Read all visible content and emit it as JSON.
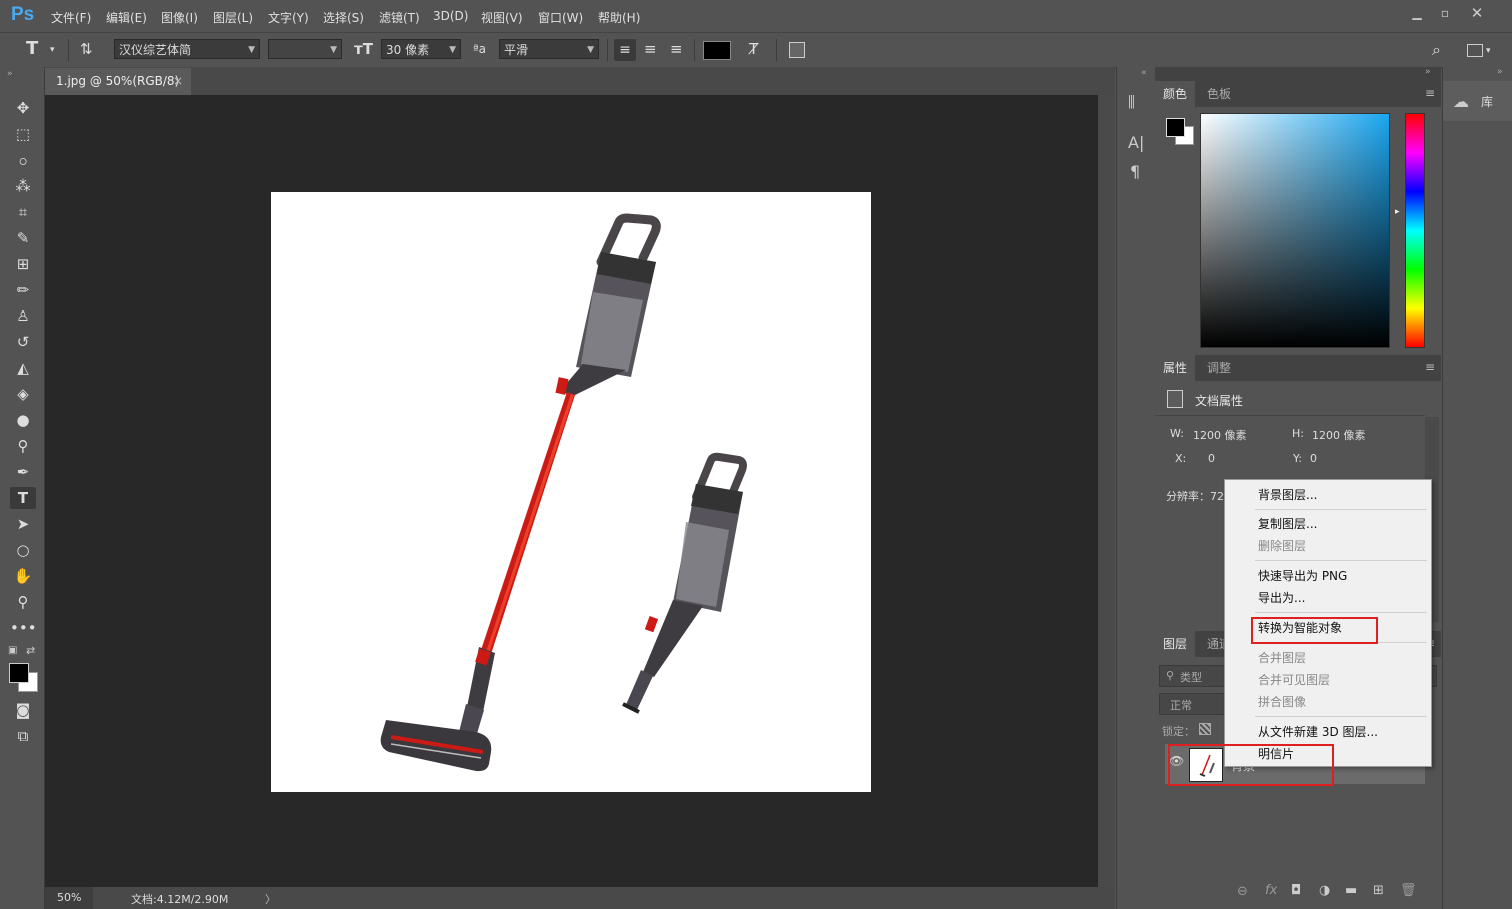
{
  "menubar": {
    "logo": "Ps",
    "items": [
      "文件(F)",
      "编辑(E)",
      "图像(I)",
      "图层(L)",
      "文字(Y)",
      "选择(S)",
      "滤镜(T)",
      "3D(D)",
      "视图(V)",
      "窗口(W)",
      "帮助(H)"
    ]
  },
  "options": {
    "font_family": "汉仪综艺体简",
    "font_style": "",
    "font_size": "30 像素",
    "antialias": "平滑",
    "color": "#000000"
  },
  "document": {
    "tab_title": "1.jpg @ 50%(RGB/8)",
    "tab_close": "×",
    "zoom": "50%",
    "doc_info": "文档:4.12M/2.90M",
    "status_arrow": "〉"
  },
  "color_panel": {
    "tabs": [
      "颜色",
      "色板"
    ],
    "foreground": "#000000",
    "background": "#ffffff"
  },
  "properties_panel": {
    "tabs": [
      "属性",
      "调整"
    ],
    "section_title": "文档属性",
    "w_label": "W:",
    "w_value": "1200 像素",
    "h_label": "H:",
    "h_value": "1200 像素",
    "x_label": "X:",
    "x_value": "0",
    "y_label": "Y:",
    "y_value": "0",
    "resolution_label": "分辨率：72"
  },
  "layers_panel": {
    "tabs": [
      "图层",
      "通道"
    ],
    "filter_label": "类型",
    "blend_mode": "正常",
    "lock_label": "锁定：",
    "layer_name": "背景"
  },
  "library_panel": {
    "label": "库"
  },
  "context_menu": {
    "items": [
      {
        "label": "背景图层...",
        "enabled": true
      },
      {
        "label": "复制图层...",
        "enabled": true
      },
      {
        "label": "删除图层",
        "enabled": false
      },
      {
        "label": "快速导出为 PNG",
        "enabled": true
      },
      {
        "label": "导出为...",
        "enabled": true
      },
      {
        "label": "转换为智能对象",
        "enabled": true
      },
      {
        "label": "合并图层",
        "enabled": false
      },
      {
        "label": "合并可见图层",
        "enabled": false
      },
      {
        "label": "拼合图像",
        "enabled": false
      },
      {
        "label": "从文件新建 3D 图层...",
        "enabled": true
      },
      {
        "label": "明信片",
        "enabled": true
      }
    ]
  },
  "colors": {
    "highlight_box": "#e02020",
    "accent_red": "#cc1a14"
  }
}
